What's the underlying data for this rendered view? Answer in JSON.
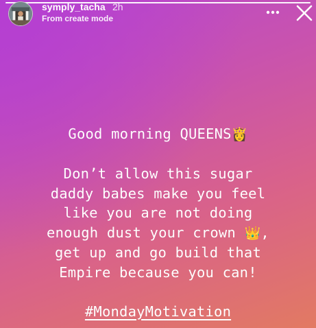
{
  "header": {
    "username": "symply_tacha",
    "time": "2h",
    "subtitle": "From create mode",
    "more_icon": "more-dots-icon",
    "close_icon": "close-x-icon"
  },
  "story": {
    "line1": "Good morning QUEENS",
    "emoji_queen": "👸",
    "line2": "Don’t allow this sugar",
    "line3": "daddy babes make you feel",
    "line4": "like you are not doing",
    "line5": "enough dust your crown",
    "emoji_crown": "👑",
    "line5_tail": ",",
    "line6": "get up and go build that",
    "line7": "Empire because you can!",
    "hashtag": "#MondayMotivation"
  },
  "colors": {
    "gradient_top_left": "#b53ed2",
    "gradient_bottom_right": "#e27a62",
    "text": "#ffffff"
  }
}
